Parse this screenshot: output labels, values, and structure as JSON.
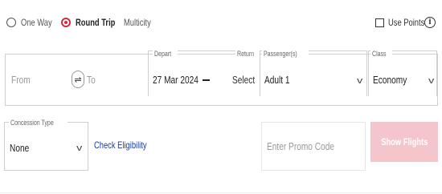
{
  "trip_type": {
    "options": [
      {
        "label": "One Way",
        "selected": false
      },
      {
        "label": "Round Trip",
        "selected": true
      },
      {
        "label": "Multicity",
        "selected": false
      }
    ]
  },
  "use_points": {
    "label": "Use Points",
    "checked": false,
    "info_icon": "i"
  },
  "search": {
    "from_placeholder": "From",
    "swap_icon": "⇌",
    "to_placeholder": "To",
    "depart_label": "Depart",
    "depart_value": "27 Mar 2024",
    "return_label": "Return",
    "return_value": "Select",
    "passengers_label": "Passenger(s)",
    "passengers_value": "Adult 1",
    "class_label": "Class",
    "class_value": "Economy"
  },
  "concession": {
    "label": "Concession Type",
    "value": "None"
  },
  "check_eligibility": "Check Eligibility",
  "promo_placeholder": "Enter Promo Code",
  "show_flights": "Show Flights",
  "colors": {
    "accent": "#d42a3a",
    "button_disabled": "#f4c6cc",
    "link": "#1a3aa6"
  }
}
